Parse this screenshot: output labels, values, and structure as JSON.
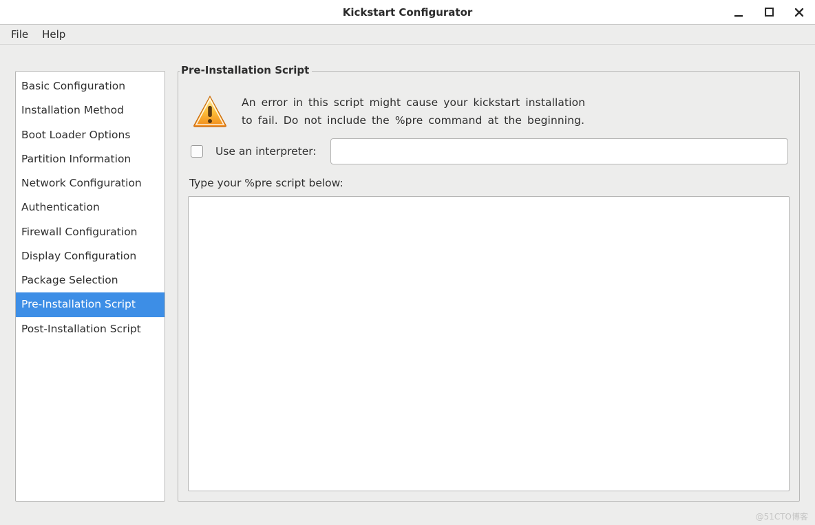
{
  "window": {
    "title": "Kickstart Configurator"
  },
  "menubar": {
    "file": "File",
    "help": "Help"
  },
  "sidebar": {
    "items": [
      {
        "label": "Basic Configuration",
        "selected": false
      },
      {
        "label": "Installation Method",
        "selected": false
      },
      {
        "label": "Boot Loader Options",
        "selected": false
      },
      {
        "label": "Partition Information",
        "selected": false
      },
      {
        "label": "Network Configuration",
        "selected": false
      },
      {
        "label": "Authentication",
        "selected": false
      },
      {
        "label": "Firewall Configuration",
        "selected": false
      },
      {
        "label": "Display Configuration",
        "selected": false
      },
      {
        "label": "Package Selection",
        "selected": false
      },
      {
        "label": "Pre-Installation Script",
        "selected": true
      },
      {
        "label": "Post-Installation Script",
        "selected": false
      }
    ]
  },
  "panel": {
    "legend": "Pre-Installation Script",
    "warning_line1": "An error in this script might cause your kickstart installation",
    "warning_line2": "to fail. Do not include the %pre command at the beginning.",
    "interpreter_checked": false,
    "interpreter_label": "Use an interpreter:",
    "interpreter_value": "",
    "type_label": "Type your %pre script below:",
    "script_value": ""
  },
  "watermark": "@51CTO博客"
}
